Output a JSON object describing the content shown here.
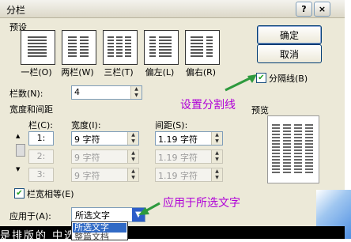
{
  "window": {
    "title": "分栏",
    "help_label": "?",
    "close_label": "×"
  },
  "presets": {
    "group_label": "预设",
    "items": [
      {
        "label": "一栏(O)"
      },
      {
        "label": "两栏(W)"
      },
      {
        "label": "三栏(T)"
      },
      {
        "label": "偏左(L)"
      },
      {
        "label": "偏右(R)"
      }
    ]
  },
  "buttons": {
    "ok": "确定",
    "cancel": "取消"
  },
  "separator": {
    "label": "分隔线(B)",
    "checked": true
  },
  "columns": {
    "label": "栏数(N):",
    "value": "4"
  },
  "width_spacing": {
    "group_label": "宽度和间距",
    "col_header": "栏(C):",
    "width_header": "宽度(I):",
    "spacing_header": "间距(S):",
    "rows": [
      {
        "col": "1:",
        "width": "9 字符",
        "spacing": "1.19 字符"
      },
      {
        "col": "2:",
        "width": "9 字符",
        "spacing": "1.19 字符"
      },
      {
        "col": "3:",
        "width": "9 字符",
        "spacing": "1.19 字符"
      }
    ]
  },
  "equal_width": {
    "label": "栏宽相等(E)",
    "checked": true
  },
  "preview": {
    "label": "预览"
  },
  "apply_to": {
    "label": "应用于(A):",
    "value": "所选文字",
    "options": [
      "所选文字",
      "整篇文档"
    ]
  },
  "annotations": {
    "separator_note": "设置分割线",
    "apply_note": "应用于所选文字"
  },
  "document": {
    "text": "是排版的    中选    是 左"
  },
  "colors": {
    "annotation": "#b000d8",
    "arrow": "#2e9a3e",
    "dialog_bg": "#ece9d8",
    "selection": "#316ac5"
  }
}
